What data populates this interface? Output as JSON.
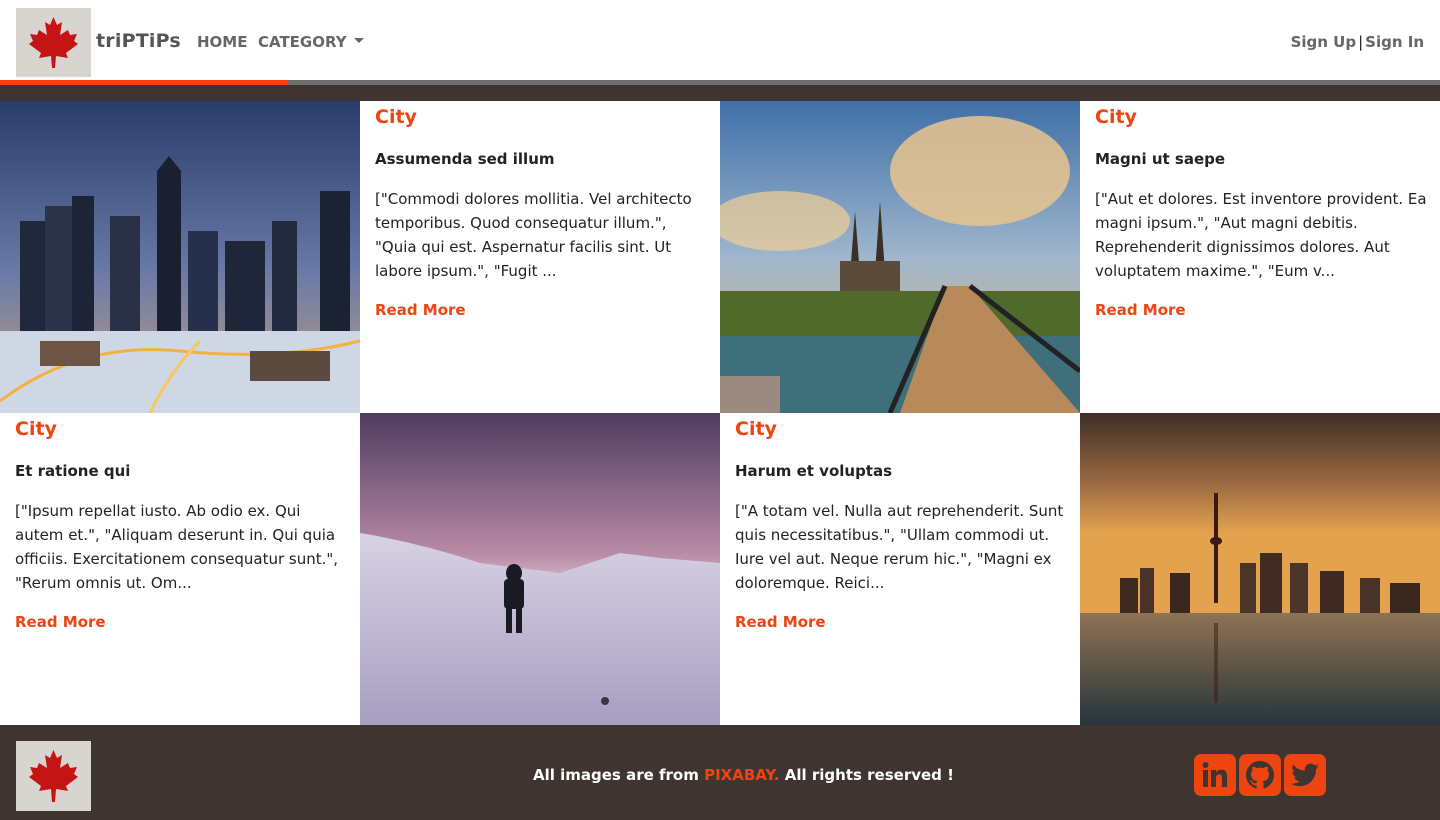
{
  "navbar": {
    "brand": "triPTiPs",
    "home_label": "HOME",
    "category_label": "CATEGORY",
    "sign_up": "Sign Up",
    "separator": "|",
    "sign_in": "Sign In"
  },
  "progress": {
    "fraction": 0.2
  },
  "colors": {
    "accent": "#ee4410",
    "dark": "#3e3531",
    "nav_text": "#666666"
  },
  "cards": [
    {
      "category": "City",
      "title": "Assumenda sed illum",
      "excerpt": "[\"Commodi dolores mollitia. Vel architecto temporibus. Quod consequatur illum.\", \"Quia qui est. Aspernatur facilis sint. Ut labore ipsum.\", \"Fugit ...",
      "link": "Read More",
      "image": "city-skyline-night"
    },
    {
      "category": "City",
      "title": "Magni ut saepe",
      "excerpt": "[\"Aut et dolores. Est inventore provident. Ea magni ipsum.\", \"Aut magni debitis. Reprehenderit dignissimos dolores. Aut voluptatem maxime.\", \"Eum v...",
      "link": "Read More",
      "image": "bridge-church-sunset"
    },
    {
      "category": "City",
      "title": "Et ratione qui",
      "excerpt": "[\"Ipsum repellat iusto. Ab odio ex. Qui autem et.\", \"Aliquam deserunt in. Qui quia officiis. Exercitationem consequatur sunt.\", \"Rerum omnis ut. Om...",
      "link": "Read More",
      "image": "person-snow-dusk"
    },
    {
      "category": "City",
      "title": "Harum et voluptas",
      "excerpt": "[\"A totam vel. Nulla aut reprehenderit. Sunt quis necessitatibus.\", \"Ullam commodi ut. Iure vel aut. Neque rerum hic.\", \"Magni ex doloremque. Reici...",
      "link": "Read More",
      "image": "toronto-skyline-reflection"
    }
  ],
  "footer": {
    "text_before": "All images are from",
    "source": "PIXABAY.",
    "text_after": "All rights reserved !",
    "social": [
      "linkedin-icon",
      "github-icon",
      "twitter-icon"
    ]
  }
}
